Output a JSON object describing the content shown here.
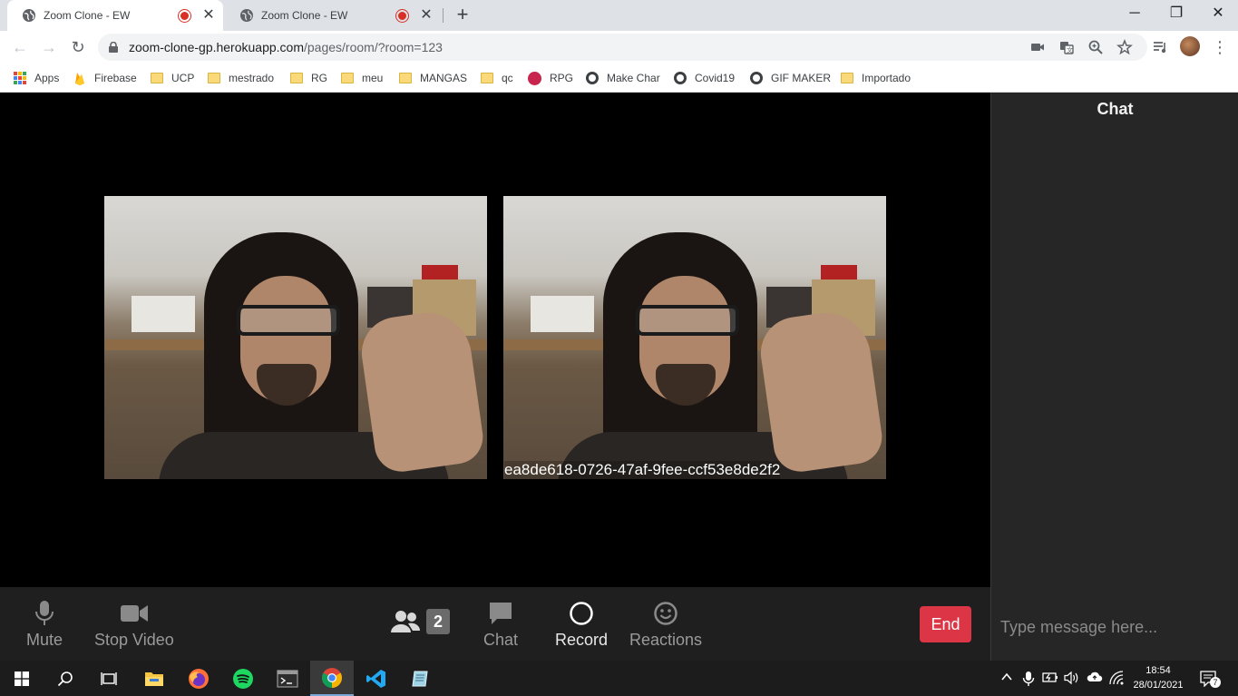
{
  "browser": {
    "tabs": [
      {
        "title": "Zoom Clone - EW",
        "active": true
      },
      {
        "title": "Zoom Clone - EW",
        "active": false
      }
    ],
    "url_host": "zoom-clone-gp.herokuapp.com",
    "url_path": "/pages/room/?room=123",
    "bookmarks": [
      "Apps",
      "Firebase",
      "UCP",
      "mestrado",
      "RG",
      "meu",
      "MANGAS",
      "qc",
      "RPG",
      "Make Char",
      "Covid19",
      "GIF MAKER",
      "Importado"
    ]
  },
  "videos": [
    {
      "label": ""
    },
    {
      "label": "ea8de618-0726-47af-9fee-ccf53e8de2f2"
    }
  ],
  "controls": {
    "mute": "Mute",
    "stop_video": "Stop Video",
    "participants_count": "2",
    "chat": "Chat",
    "record": "Record",
    "reactions": "Reactions",
    "end": "End"
  },
  "chat": {
    "title": "Chat",
    "placeholder": "Type message here..."
  },
  "taskbar": {
    "time": "18:54",
    "date": "28/01/2021",
    "notifications": "7"
  },
  "colors": {
    "end_button": "#dc3545",
    "recording_dot": "#d93025",
    "control_bar": "#1f1f1f",
    "chat_panel": "#262626"
  }
}
